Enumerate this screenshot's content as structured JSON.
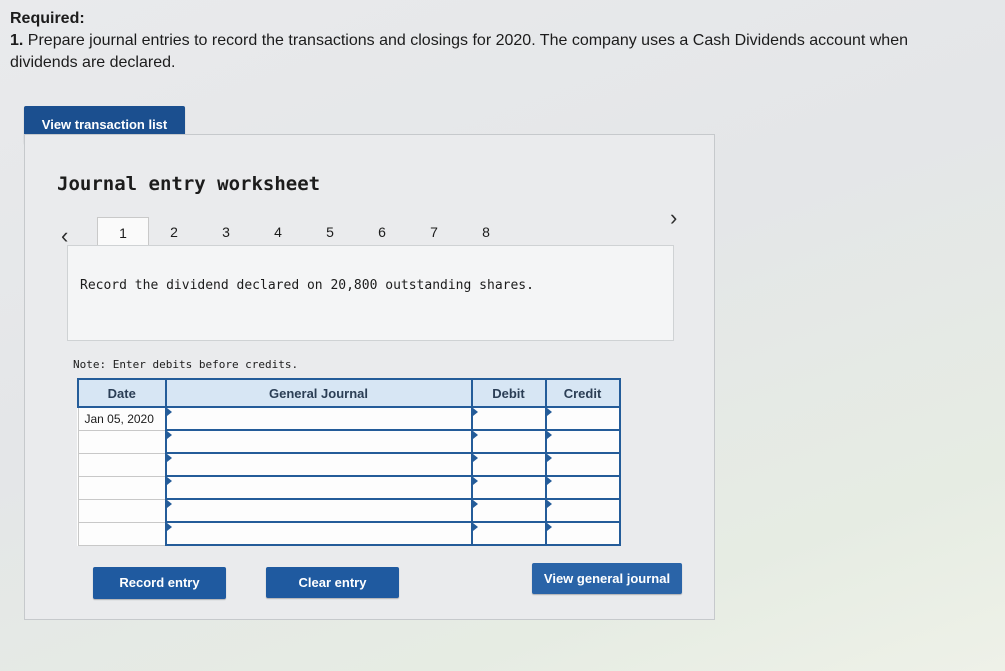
{
  "header": {
    "required_label": "Required:",
    "instruction_number": "1.",
    "instruction_text": "Prepare journal entries to record the transactions and closings for 2020. The company uses a Cash Dividends account when dividends are declared."
  },
  "buttons": {
    "view_transaction_list": "View transaction list",
    "record_entry": "Record entry",
    "clear_entry": "Clear entry",
    "view_general_journal": "View general journal"
  },
  "worksheet": {
    "title": "Journal entry worksheet",
    "tabs": [
      "1",
      "2",
      "3",
      "4",
      "5",
      "6",
      "7",
      "8"
    ],
    "active_tab": "1",
    "prompt": "Record the dividend declared on 20,800 outstanding shares.",
    "note": "Note: Enter debits before credits."
  },
  "journal": {
    "headers": {
      "date": "Date",
      "general_journal": "General Journal",
      "debit": "Debit",
      "credit": "Credit"
    },
    "rows": [
      {
        "date": "Jan 05, 2020",
        "account": "",
        "debit": "",
        "credit": ""
      },
      {
        "date": "",
        "account": "",
        "debit": "",
        "credit": ""
      },
      {
        "date": "",
        "account": "",
        "debit": "",
        "credit": ""
      },
      {
        "date": "",
        "account": "",
        "debit": "",
        "credit": ""
      },
      {
        "date": "",
        "account": "",
        "debit": "",
        "credit": ""
      },
      {
        "date": "",
        "account": "",
        "debit": "",
        "credit": ""
      }
    ]
  },
  "colors": {
    "button_blue": "#1f5aa0",
    "header_blue": "#d7e6f4",
    "border_blue": "#245c99"
  },
  "icons": {
    "prev": "chevron-left-icon",
    "next": "chevron-right-icon"
  }
}
